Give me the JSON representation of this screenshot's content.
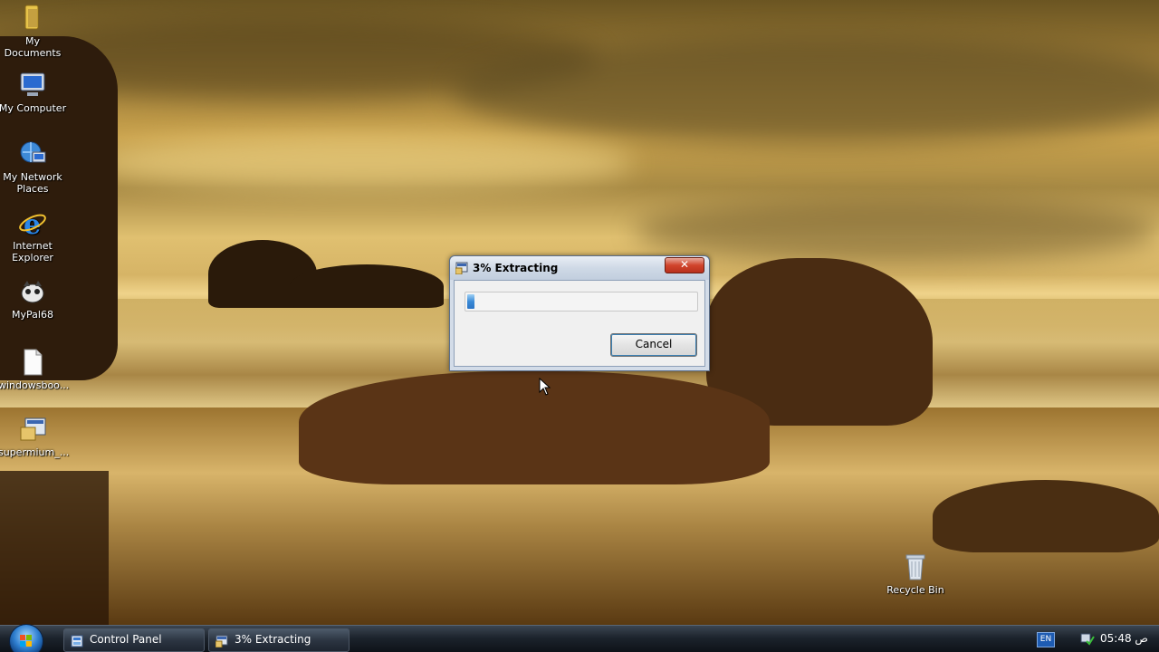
{
  "desktop": {
    "icons": [
      {
        "label": "My Documents",
        "icon": "my-documents-icon"
      },
      {
        "label": "My Computer",
        "icon": "my-computer-icon"
      },
      {
        "label": "My Network\nPlaces",
        "icon": "my-network-places-icon"
      },
      {
        "label": "Internet\nExplorer",
        "icon": "internet-explorer-icon"
      },
      {
        "label": "MyPal68",
        "icon": "mypal68-icon"
      },
      {
        "label": "windowsboo...",
        "icon": "file-icon"
      },
      {
        "label": "supermium_...",
        "icon": "installer-icon"
      },
      {
        "label": "Recycle Bin",
        "icon": "recycle-bin-icon"
      }
    ]
  },
  "dialog": {
    "title": "3% Extracting",
    "close_label": "✕",
    "progress_percent": 3,
    "cancel_label": "Cancel"
  },
  "taskbar": {
    "buttons": [
      {
        "label": "Control Panel",
        "icon": "control-panel-icon"
      },
      {
        "label": "3% Extracting",
        "icon": "extract-app-icon"
      }
    ],
    "language": "EN",
    "clock": "ص 05:48"
  },
  "colors": {
    "accent": "#2f7fd0",
    "close": "#d0442c",
    "progress": "#3a8ad6"
  }
}
